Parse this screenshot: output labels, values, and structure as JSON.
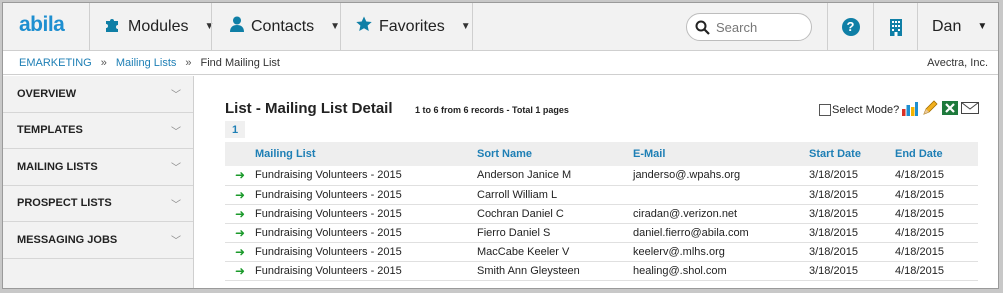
{
  "app": {
    "logo": "abila"
  },
  "nav": {
    "modules": "Modules",
    "contacts": "Contacts",
    "favorites": "Favorites",
    "search_placeholder": "Search",
    "help": "?",
    "user": "Dan"
  },
  "breadcrumb": {
    "items": [
      "EMARKETING",
      "Mailing Lists"
    ],
    "separator": "»",
    "current": "Find Mailing List",
    "organization": "Avectra, Inc."
  },
  "sidebar": {
    "items": [
      {
        "label": "OVERVIEW"
      },
      {
        "label": "TEMPLATES"
      },
      {
        "label": "MAILING LISTS"
      },
      {
        "label": "PROSPECT LISTS"
      },
      {
        "label": "MESSAGING JOBS"
      }
    ]
  },
  "main": {
    "title": "List - Mailing List Detail",
    "records_info": "1 to 6 from 6 records - Total 1 pages",
    "page": "1",
    "select_mode_label": "Select Mode?",
    "columns": [
      "Mailing List",
      "Sort Name",
      "E-Mail",
      "Start Date",
      "End Date"
    ],
    "rows": [
      [
        "Fundraising Volunteers - 2015",
        "Anderson Janice M",
        "janderso@.wpahs.org",
        "3/18/2015",
        "4/18/2015"
      ],
      [
        "Fundraising Volunteers - 2015",
        "Carroll William L",
        "",
        "3/18/2015",
        "4/18/2015"
      ],
      [
        "Fundraising Volunteers - 2015",
        "Cochran Daniel C",
        "ciradan@.verizon.net",
        "3/18/2015",
        "4/18/2015"
      ],
      [
        "Fundraising Volunteers - 2015",
        "Fierro Daniel S",
        "daniel.fierro@abila.com",
        "3/18/2015",
        "4/18/2015"
      ],
      [
        "Fundraising Volunteers - 2015",
        "MacCabe Keeler V",
        "keelerv@.mlhs.org",
        "3/18/2015",
        "4/18/2015"
      ],
      [
        "Fundraising Volunteers - 2015",
        "Smith Ann Gleysteen",
        "healing@.shol.com",
        "3/18/2015",
        "4/18/2015"
      ]
    ]
  },
  "icons": {
    "modules": "puzzle-icon",
    "contacts": "person-icon",
    "favorites": "star-icon",
    "search": "search-icon",
    "help": "help-icon",
    "organization": "building-icon",
    "row_action": "go-arrow-icon",
    "chart": "chart-icon",
    "edit": "pencil-icon",
    "excel": "excel-icon",
    "email": "envelope-icon"
  },
  "colors": {
    "brand": "#1e8fd0",
    "accent": "#0f7fa6",
    "link": "#1e7fb5",
    "row_arrow": "#1a9a2a"
  }
}
